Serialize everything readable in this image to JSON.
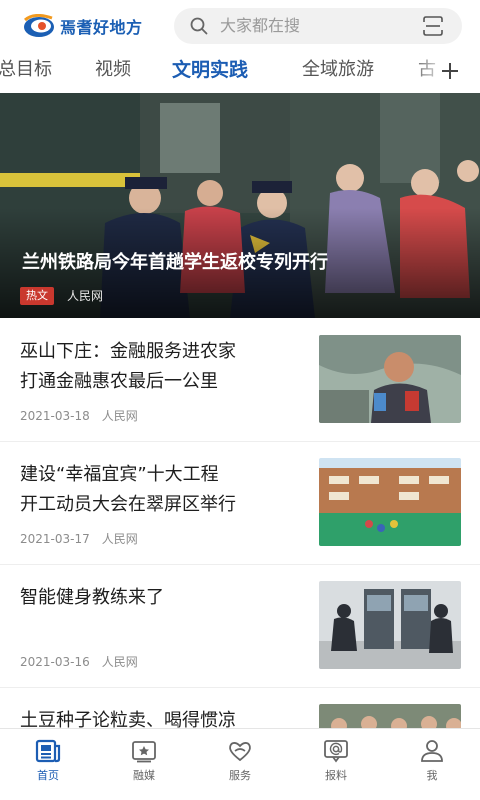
{
  "header": {
    "logo_text": "焉耆好地方",
    "search_placeholder": "大家都在搜",
    "icons": {
      "logo": "app-logo",
      "search": "search-icon",
      "scan": "scan-icon"
    }
  },
  "tabs": {
    "items": [
      "总目标",
      "视频",
      "文明实践",
      "全域旅游",
      "古"
    ],
    "active_index": 2,
    "add_icon": "plus-icon"
  },
  "banner": {
    "title": "兰州铁路局今年首趟学生返校专列开行",
    "tag": "热文",
    "source": "人民网"
  },
  "news": [
    {
      "title_line1": "巫山下庄：金融服务进农家",
      "title_line2": "打通金融惠农最后一公里",
      "date": "2021-03-18",
      "source": "人民网"
    },
    {
      "title_line1": "建设“幸福宜宾”十大工程",
      "title_line2": "开工动员大会在翠屏区举行",
      "date": "2021-03-17",
      "source": "人民网"
    },
    {
      "title_line1": "智能健身教练来了",
      "title_line2": "",
      "date": "2021-03-16",
      "source": "人民网"
    },
    {
      "title_line1": "土豆种子论粒卖、喝得惯凉",
      "title_line2": "",
      "date": "",
      "source": ""
    }
  ],
  "bottom_nav": {
    "items": [
      {
        "label": "首页",
        "icon": "newspaper-icon"
      },
      {
        "label": "融媒",
        "icon": "media-icon"
      },
      {
        "label": "服务",
        "icon": "heart-hands-icon"
      },
      {
        "label": "报料",
        "icon": "at-message-icon"
      },
      {
        "label": "我",
        "icon": "user-icon"
      }
    ],
    "active_index": 0
  },
  "colors": {
    "accent": "#1c5db3",
    "hot_tag": "#c9382e",
    "muted_text": "#8c8c8c"
  }
}
